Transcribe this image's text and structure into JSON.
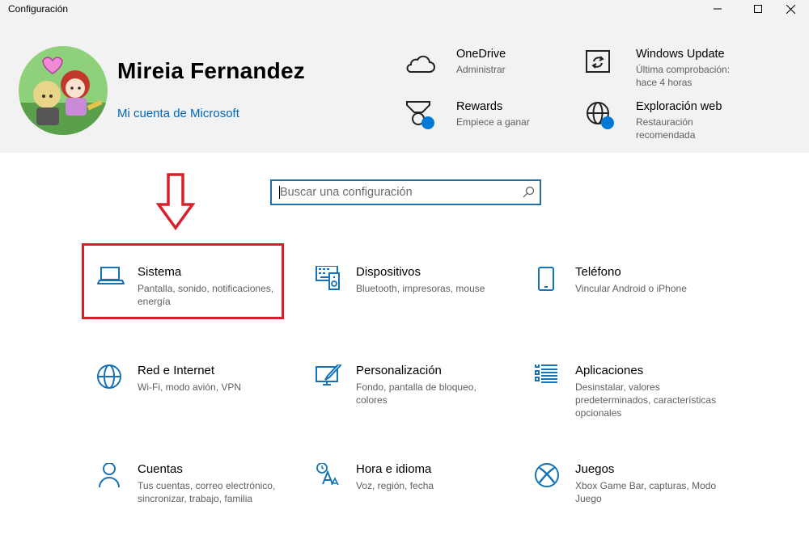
{
  "window": {
    "title": "Configuración"
  },
  "profile": {
    "name": "Mireia Fernandez",
    "account_link": "Mi cuenta de Microsoft"
  },
  "header_items": [
    {
      "title": "OneDrive",
      "subtitle": "Administrar",
      "icon": "cloud-icon"
    },
    {
      "title": "Windows Update",
      "subtitle": "Última comprobación: hace 4 horas",
      "icon": "sync-icon"
    },
    {
      "title": "Rewards",
      "subtitle": "Empiece a ganar",
      "icon": "medal-icon"
    },
    {
      "title": "Exploración web",
      "subtitle": "Restauración recomendada",
      "icon": "globe-icon"
    }
  ],
  "search": {
    "placeholder": "Buscar una configuración"
  },
  "accent_color": "#0067b8",
  "highlight_color": "#d6212b",
  "tiles": [
    {
      "title": "Sistema",
      "subtitle": "Pantalla, sonido, notificaciones, energía",
      "icon": "laptop-icon"
    },
    {
      "title": "Dispositivos",
      "subtitle": "Bluetooth, impresoras, mouse",
      "icon": "keyboard-speaker-icon"
    },
    {
      "title": "Teléfono",
      "subtitle": "Vincular Android o iPhone",
      "icon": "phone-icon"
    },
    {
      "title": "Red e Internet",
      "subtitle": "Wi-Fi, modo avión, VPN",
      "icon": "globe-icon"
    },
    {
      "title": "Personalización",
      "subtitle": "Fondo, pantalla de bloqueo, colores",
      "icon": "paint-icon"
    },
    {
      "title": "Aplicaciones",
      "subtitle": "Desinstalar, valores predeterminados, características opcionales",
      "icon": "apps-list-icon"
    },
    {
      "title": "Cuentas",
      "subtitle": "Tus cuentas, correo electrónico, sincronizar, trabajo, familia",
      "icon": "person-icon"
    },
    {
      "title": "Hora e idioma",
      "subtitle": "Voz, región, fecha",
      "icon": "time-language-icon"
    },
    {
      "title": "Juegos",
      "subtitle": "Xbox Game Bar, capturas, Modo Juego",
      "icon": "xbox-icon"
    }
  ]
}
